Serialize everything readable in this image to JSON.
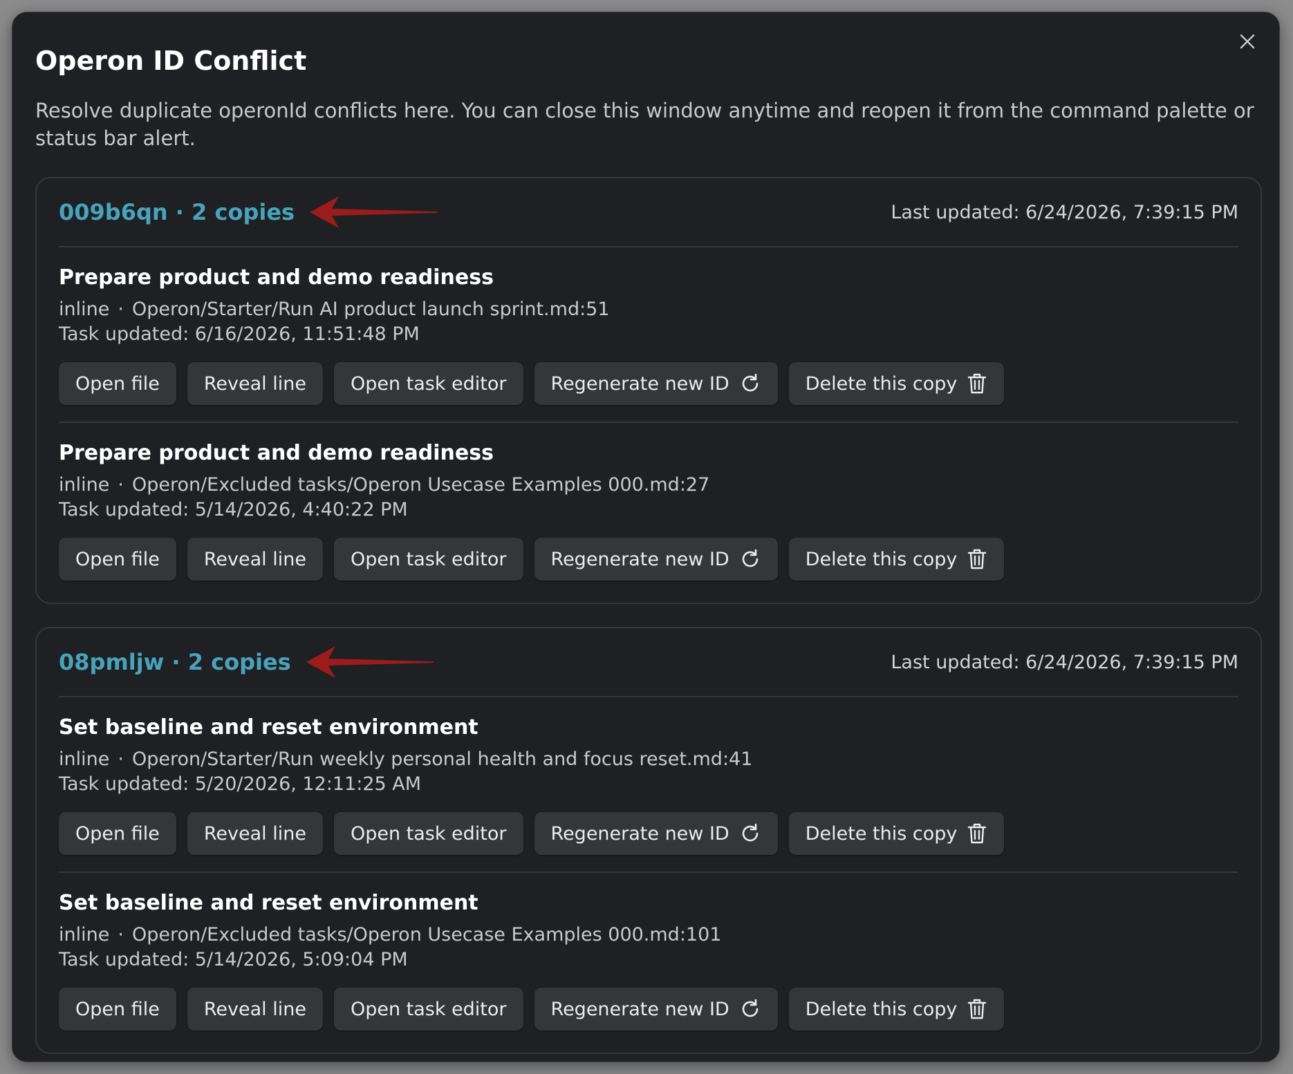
{
  "dialog": {
    "title": "Operon ID Conflict",
    "description": "Resolve duplicate operonId conflicts here. You can close this window anytime and reopen it from the command palette or status bar alert.",
    "close_icon": "close-icon"
  },
  "labels": {
    "open_file": "Open file",
    "reveal_line": "Reveal line",
    "open_task_editor": "Open task editor",
    "regenerate": "Regenerate new ID",
    "delete_copy": "Delete this copy",
    "separator": "·"
  },
  "colors": {
    "accent": "#48a3bb",
    "arrow": "#9c1c1c",
    "background": "#1f2023",
    "button": "#35363a"
  },
  "groups": [
    {
      "id_label": "009b6qn · 2 copies",
      "last_updated": "Last updated: 6/24/2026, 7:39:15 PM",
      "copies": [
        {
          "title": "Prepare product and demo readiness",
          "kind": "inline",
          "path": "Operon/Starter/Run AI product launch sprint.md:51",
          "updated": "Task updated: 6/16/2026, 11:51:48 PM"
        },
        {
          "title": "Prepare product and demo readiness",
          "kind": "inline",
          "path": "Operon/Excluded tasks/Operon Usecase Examples 000.md:27",
          "updated": "Task updated: 5/14/2026, 4:40:22 PM"
        }
      ]
    },
    {
      "id_label": "08pmljw · 2 copies",
      "last_updated": "Last updated: 6/24/2026, 7:39:15 PM",
      "copies": [
        {
          "title": "Set baseline and reset environment",
          "kind": "inline",
          "path": "Operon/Starter/Run weekly personal health and focus reset.md:41",
          "updated": "Task updated: 5/20/2026, 12:11:25 AM"
        },
        {
          "title": "Set baseline and reset environment",
          "kind": "inline",
          "path": "Operon/Excluded tasks/Operon Usecase Examples 000.md:101",
          "updated": "Task updated: 5/14/2026, 5:09:04 PM"
        }
      ]
    }
  ]
}
